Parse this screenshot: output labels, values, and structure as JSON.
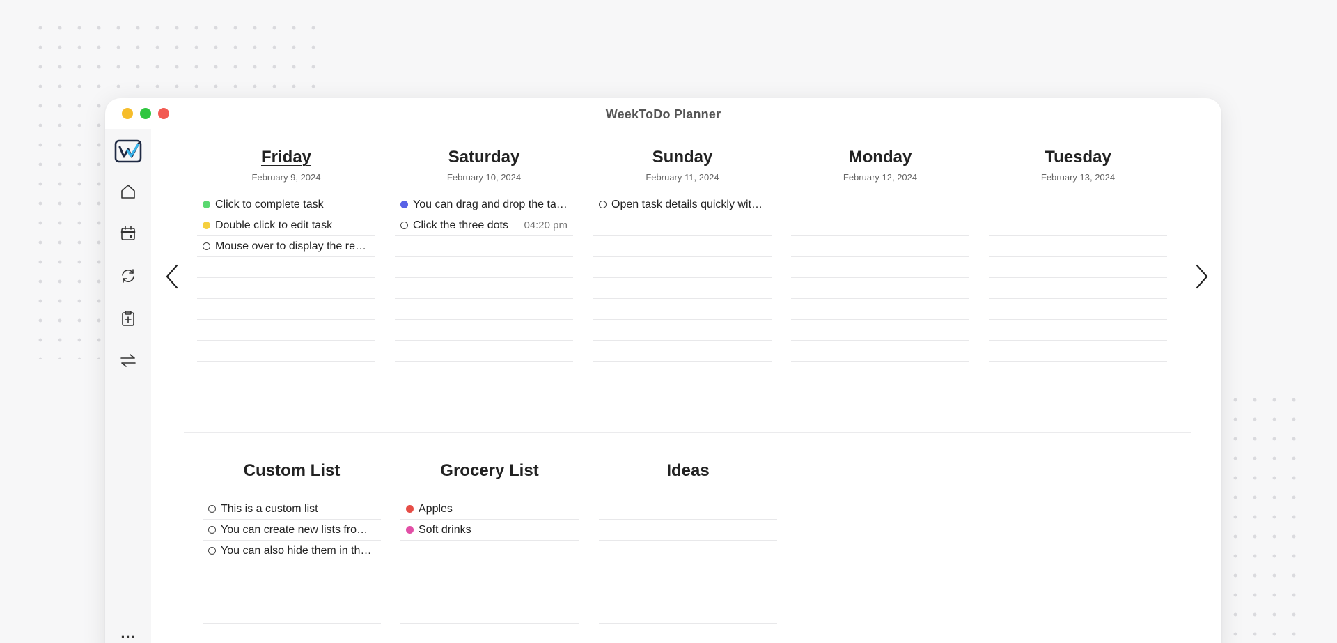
{
  "app": {
    "title": "WeekToDo Planner"
  },
  "colors": {
    "green": "#5ad870",
    "yellow": "#f5cf3e",
    "purple": "#5862e6",
    "red": "#e64d46",
    "pink": "#e24fa6"
  },
  "sidebar": {
    "items": [
      {
        "name": "logo",
        "icon": "weektodo-logo-icon"
      },
      {
        "name": "home",
        "icon": "home-icon"
      },
      {
        "name": "calendar",
        "icon": "calendar-icon"
      },
      {
        "name": "sync",
        "icon": "sync-icon"
      },
      {
        "name": "add-task",
        "icon": "clipboard-plus-icon"
      },
      {
        "name": "switch",
        "icon": "switch-arrows-icon"
      }
    ],
    "more": "..."
  },
  "navigation": {
    "prev_icon": "chevron-left-icon",
    "next_icon": "chevron-right-icon"
  },
  "days": [
    {
      "name": "Friday",
      "date": "February 9, 2024",
      "today": true,
      "tasks": [
        {
          "text": "Click to complete task",
          "color": "#5ad870"
        },
        {
          "text": "Double click to edit task",
          "color": "#f5cf3e"
        },
        {
          "text": "Mouse over to display the remaining text",
          "color": null
        }
      ]
    },
    {
      "name": "Saturday",
      "date": "February 10, 2024",
      "today": false,
      "tasks": [
        {
          "text": "You can drag and drop the tasks",
          "color": "#5862e6"
        },
        {
          "text": "Click the three dots",
          "color": null,
          "time": "04:20 pm"
        }
      ]
    },
    {
      "name": "Sunday",
      "date": "February 11, 2024",
      "today": false,
      "tasks": [
        {
          "text": "Open task details quickly with a click",
          "color": null
        }
      ]
    },
    {
      "name": "Monday",
      "date": "February 12, 2024",
      "today": false,
      "tasks": []
    },
    {
      "name": "Tuesday",
      "date": "February 13, 2024",
      "today": false,
      "tasks": []
    }
  ],
  "lists": [
    {
      "name": "Custom List",
      "tasks": [
        {
          "text": "This is a custom list",
          "color": null
        },
        {
          "text": "You can create new lists from the menu",
          "color": null
        },
        {
          "text": "You can also hide them in the settings",
          "color": null
        }
      ]
    },
    {
      "name": "Grocery List",
      "tasks": [
        {
          "text": "Apples",
          "color": "#e64d46"
        },
        {
          "text": "Soft drinks",
          "color": "#e24fa6"
        }
      ]
    },
    {
      "name": "Ideas",
      "tasks": []
    }
  ]
}
